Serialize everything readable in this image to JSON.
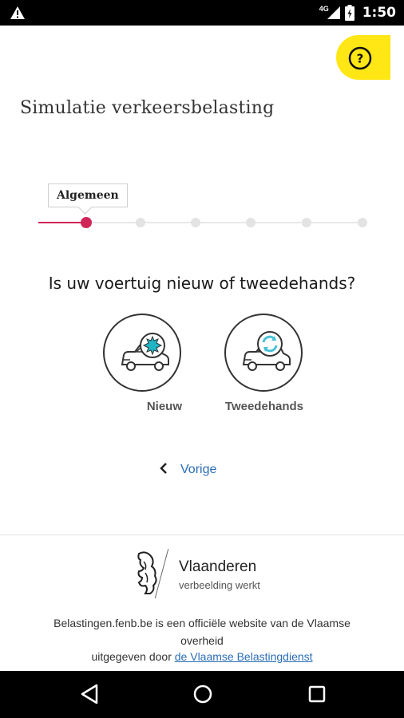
{
  "status_bar": {
    "network": "4G",
    "time": "1:50"
  },
  "help": {
    "label": "?"
  },
  "page": {
    "title": "Simulatie verkeersbelasting"
  },
  "stepper": {
    "current_step_label": "Algemeen",
    "total_steps": 6,
    "current_step": 1
  },
  "question": {
    "text": "Is uw voertuig nieuw of tweedehands?",
    "options": [
      {
        "label": "Nieuw",
        "icon": "new-car-icon"
      },
      {
        "label": "Tweedehands",
        "icon": "used-car-icon"
      }
    ]
  },
  "navigation": {
    "back_label": "Vorige"
  },
  "footer": {
    "logo_name": "Vlaanderen",
    "logo_slogan": "verbeelding werkt",
    "line1": "Belastingen.fenb.be is een officiële website van de Vlaamse",
    "line2": "overheid",
    "line3_prefix": "uitgegeven door ",
    "line3_link": "de Vlaamse Belastingdienst"
  },
  "colors": {
    "accent_pink": "#cf2657",
    "help_yellow": "#ffe615",
    "link_blue": "#2b6db6",
    "new_badge": "#1fb5c4",
    "used_badge": "#4ac1d6"
  }
}
